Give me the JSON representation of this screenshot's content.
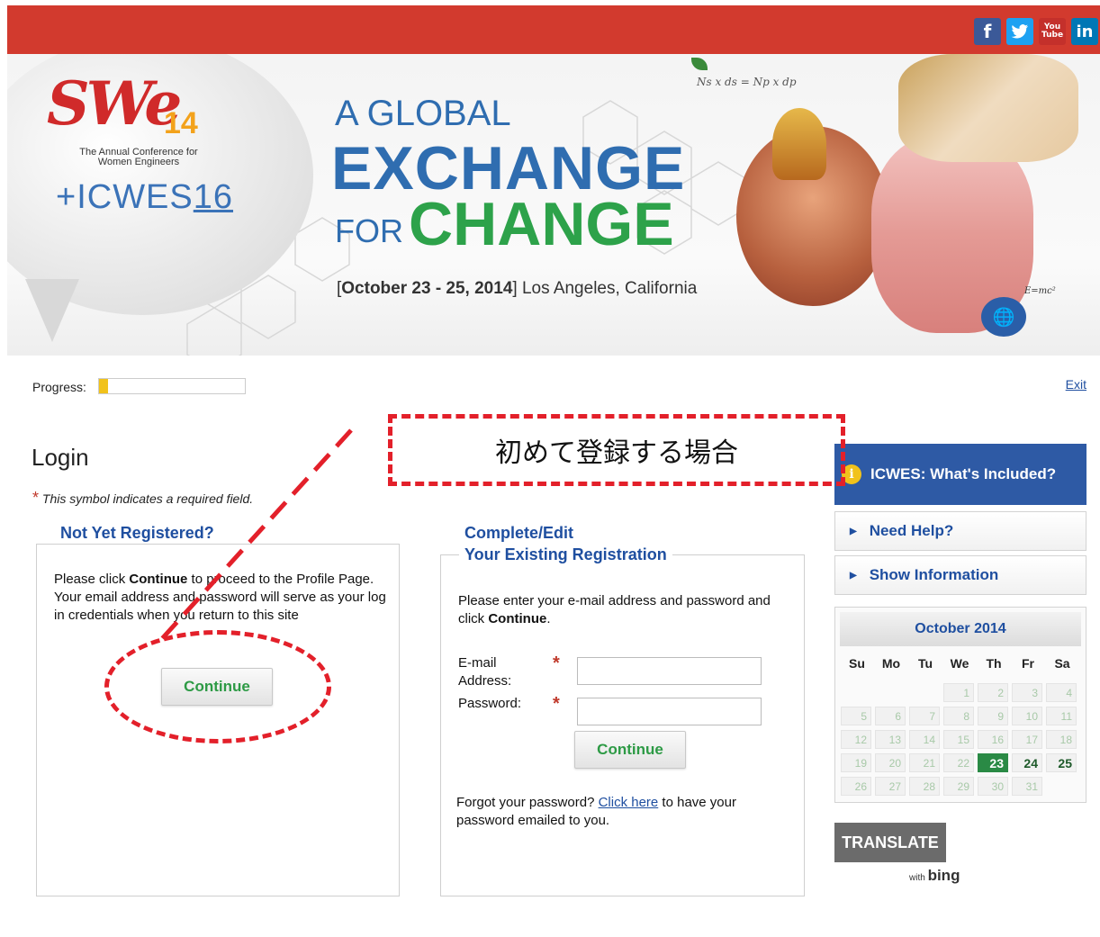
{
  "social": {
    "facebook": "f",
    "twitter": "t",
    "youtube_top": "You",
    "youtube_bottom": "Tube",
    "linkedin": "in"
  },
  "banner": {
    "logo_swe": "SWe",
    "logo_year": "14",
    "logo_subtitle": "The Annual Conference for Women Engineers",
    "logo_icwes": "+ICWES",
    "logo_icwes_num": "16",
    "headline_1": "A GLOBAL",
    "headline_2": "EXCHANGE",
    "headline_3": "FOR",
    "headline_4": "CHANGE",
    "date_bold": "October 23 - 25, 2014",
    "location": "Los Angeles, California",
    "formula_top": "Ns x ds = Np x dp",
    "formula_bottom": "E=mc²"
  },
  "progress": {
    "label": "Progress:",
    "value_percent": 6
  },
  "exit_label": "Exit",
  "login": {
    "title": "Login",
    "required_star": "*",
    "required_note": "This symbol indicates a required field."
  },
  "not_registered": {
    "legend": "Not Yet Registered?",
    "text_before": "Please click ",
    "text_bold": "Continue",
    "text_after": " to proceed to the Profile Page. Your email address and password will serve as your log in credentials when you return to this site",
    "button": "Continue"
  },
  "existing": {
    "legend_line1": "Complete/Edit",
    "legend_line2": "Your Existing Registration",
    "text_before": "Please enter your e-mail address and password and click ",
    "text_bold": "Continue",
    "text_after": ".",
    "email_label": "E-mail Address:",
    "password_label": "Password:",
    "email_value": "",
    "password_value": "",
    "button": "Continue",
    "forgot_before": "Forgot your password? ",
    "forgot_link": "Click here",
    "forgot_after": " to have your password emailed to you."
  },
  "sidebar": {
    "included": "ICWES: What's Included?",
    "info_icon": "i",
    "need_help": "Need Help?",
    "show_info": "Show Information",
    "calendar_title": "October 2014",
    "days": [
      "Su",
      "Mo",
      "Tu",
      "We",
      "Th",
      "Fr",
      "Sa"
    ],
    "weeks": [
      [
        "",
        "",
        "",
        "1",
        "2",
        "3",
        "4"
      ],
      [
        "5",
        "6",
        "7",
        "8",
        "9",
        "10",
        "11"
      ],
      [
        "12",
        "13",
        "14",
        "15",
        "16",
        "17",
        "18"
      ],
      [
        "19",
        "20",
        "21",
        "22",
        "23",
        "24",
        "25"
      ],
      [
        "26",
        "27",
        "28",
        "29",
        "30",
        "31",
        ""
      ]
    ],
    "event_days": [
      "23",
      "24",
      "25"
    ],
    "today": "23",
    "translate": "TRANSLATE",
    "bing_with": "with",
    "bing_name": "bing"
  },
  "annotation": {
    "label": "初めて登録する場合"
  },
  "colors": {
    "topbar": "#d23a2e",
    "link_blue": "#1f4fa0",
    "green": "#2d9a45",
    "annotation_red": "#e3202a",
    "progress_fill": "#f1c21b"
  }
}
